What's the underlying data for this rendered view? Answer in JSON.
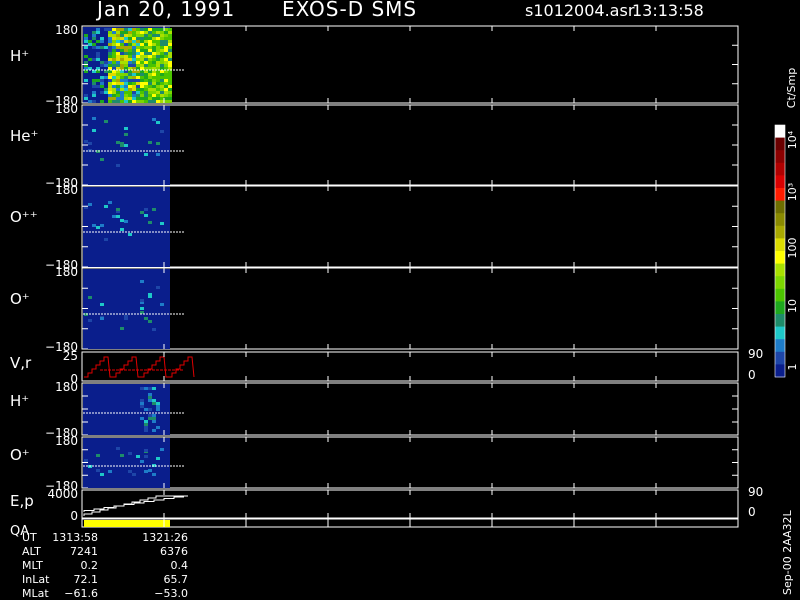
{
  "header": {
    "date": "Jan 20, 1991",
    "instrument": "EXOS-D SMS",
    "file": "s1012004.asr",
    "time": "13:13:58"
  },
  "colorbar": {
    "unit": "Ct/Smp",
    "labels": [
      "10⁴",
      "10³",
      "100",
      "10",
      "1"
    ],
    "colors": [
      "#ffffff",
      "#6a0000",
      "#8c0000",
      "#b00000",
      "#d80000",
      "#ff1c00",
      "#6e6e00",
      "#8a8a00",
      "#a8a800",
      "#dcdc00",
      "#ffff00",
      "#a8e000",
      "#7cd600",
      "#4cc400",
      "#1ea81e",
      "#1e8c6a",
      "#1ec8c8",
      "#1e7cc8",
      "#1e46a8",
      "#0a1e8c"
    ]
  },
  "panels": [
    {
      "id": "h-plus",
      "label": "H⁺",
      "ytop": "180",
      "ybot": "−180"
    },
    {
      "id": "he-plus",
      "label": "He⁺",
      "ytop": "180",
      "ybot": "−180"
    },
    {
      "id": "o-pp",
      "label": "O⁺⁺",
      "ytop": "180",
      "ybot": "−180"
    },
    {
      "id": "o-plus",
      "label": "O⁺",
      "ytop": "180",
      "ybot": "−180"
    },
    {
      "id": "vr",
      "label": "V,r",
      "ytop": "25",
      "ybot": "0",
      "rtop": "90",
      "rbot": "0"
    },
    {
      "id": "h-plus-2",
      "label": "H⁺",
      "ytop": "180",
      "ybot": "−180"
    },
    {
      "id": "o-plus-2",
      "label": "O⁺",
      "ytop": "180",
      "ybot": "−180"
    },
    {
      "id": "ep",
      "label": "E,p",
      "ytop": "4000",
      "ybot": "0",
      "rtop": "90",
      "rbot": "0"
    },
    {
      "id": "qa",
      "label": "QA"
    }
  ],
  "ephemeris": {
    "rows": [
      {
        "name": "UT",
        "v1": "1313:58",
        "v2": "1321:26"
      },
      {
        "name": "ALT",
        "v1": "7241",
        "v2": "6376"
      },
      {
        "name": "MLT",
        "v1": "0.2",
        "v2": "0.4"
      },
      {
        "name": "InLat",
        "v1": "72.1",
        "v2": "65.7"
      },
      {
        "name": "MLat",
        "v1": "−61.6",
        "v2": "−53.0"
      }
    ]
  },
  "footer_id": "Sep-00 2AA32L",
  "chart_data": {
    "type": "heatmap",
    "x": [
      "1313:58",
      "1321:26"
    ],
    "series": [
      {
        "name": "H⁺",
        "ylim": [
          -180,
          180
        ]
      },
      {
        "name": "He⁺",
        "ylim": [
          -180,
          180
        ]
      },
      {
        "name": "O⁺⁺",
        "ylim": [
          -180,
          180
        ]
      },
      {
        "name": "O⁺",
        "ylim": [
          -180,
          180
        ]
      },
      {
        "name": "V,r",
        "ylim": [
          0,
          25
        ],
        "ylim_right": [
          0,
          90
        ]
      },
      {
        "name": "H⁺",
        "ylim": [
          -180,
          180
        ]
      },
      {
        "name": "O⁺",
        "ylim": [
          -180,
          180
        ]
      },
      {
        "name": "E,p",
        "ylim": [
          0,
          4000
        ],
        "ylim_right": [
          0,
          90
        ]
      }
    ],
    "colorscale": {
      "unit": "Ct/Smp",
      "range": [
        1,
        10000
      ],
      "log": true
    }
  }
}
